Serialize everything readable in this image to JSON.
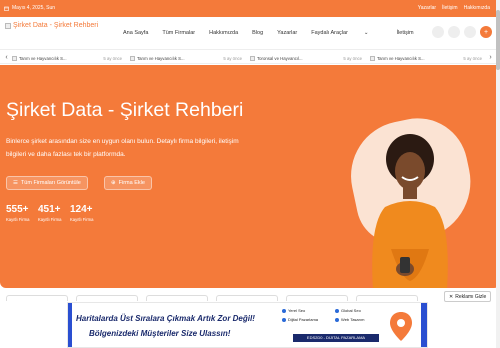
{
  "topbar": {
    "date": "Mayıs 4, 2025, Sun",
    "links": [
      "Yazarlar",
      "İletişim",
      "Hakkımızda"
    ]
  },
  "header": {
    "logo_alt": "Şirket Data - Şirket Rehberi",
    "nav": [
      "Ana Sayfa",
      "Tüm Firmalar",
      "Hakkımızda",
      "Blog",
      "Yazarlar",
      "Faydalı Araçlar",
      "İletişim"
    ]
  },
  "ticker": {
    "items": [
      {
        "title": "Tarım ve Hayvancılık S...",
        "time": "5 ay önce"
      },
      {
        "title": "Tarım ve Hayvancılık S...",
        "time": "5 ay önce"
      },
      {
        "title": "Toronsal ve Hayvancıl...",
        "time": "5 ay önce"
      },
      {
        "title": "Tarım ve Hayvancılık S...",
        "time": "5 ay önce"
      }
    ]
  },
  "hero": {
    "title": "Şirket Data - Şirket Rehberi",
    "description": "Binlerce şirket arasından size en uygun olanı bulun. Detaylı firma bilgileri, iletişim bilgileri ve daha fazlası tek bir platformda.",
    "btn_all": "Tüm Firmaları Görüntüle",
    "btn_add": "Firma Ekle",
    "stats": [
      {
        "num": "555+",
        "label": "Kayıtlı Firma"
      },
      {
        "num": "451+",
        "label": "Kayıtlı Firma"
      },
      {
        "num": "124+",
        "label": "Kayıtlı Firma"
      }
    ]
  },
  "ad": {
    "close_label": "Reklamı Gizle",
    "line1": "Haritalarda Üst Sıralara Çıkmak Artık Zor Değil!",
    "line2": "Bölgenizdeki Müşteriler Size Ulassın!",
    "features": [
      "Yerel Seo",
      "Global Seo",
      "Dijital Pazarlama",
      "Web Tasarım"
    ],
    "promo": "EDS2D0 - DIJITAL PAZARLAMA"
  },
  "colors": {
    "accent": "#f47a3a",
    "ad_blue": "#1a2a6c"
  }
}
